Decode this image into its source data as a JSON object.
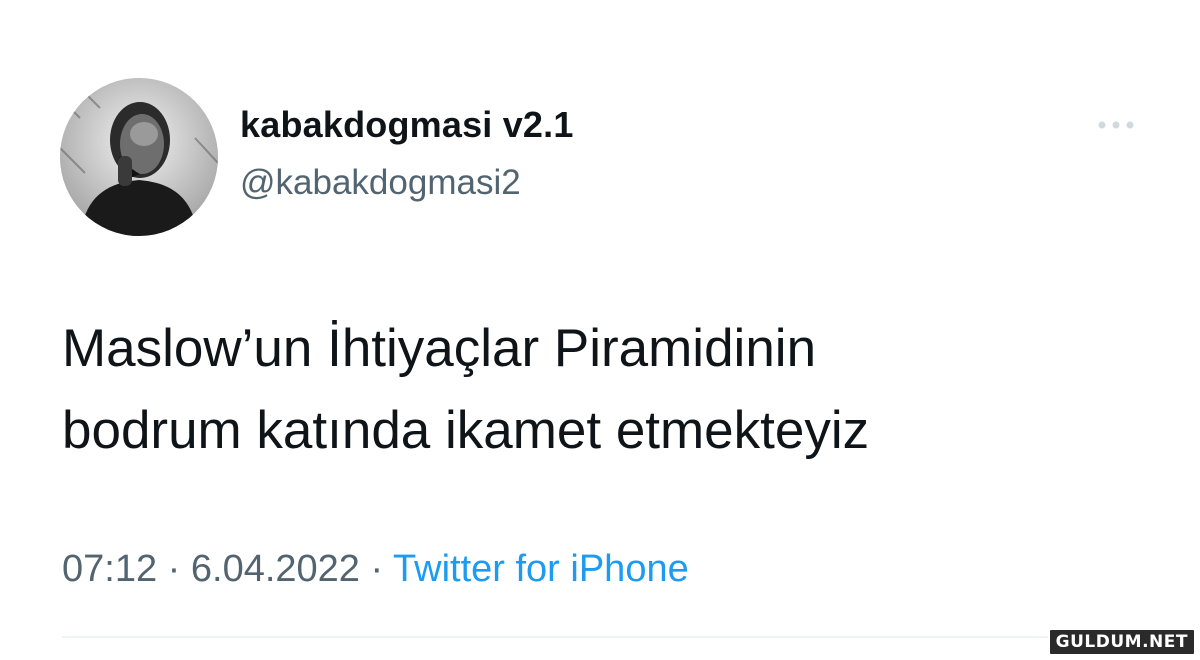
{
  "author": {
    "display_name": "kabakdogmasi v2.1",
    "handle": "@kabakdogmasi2",
    "avatar_icon": "profile-photo"
  },
  "menu": {
    "icon": "more-options-icon"
  },
  "tweet": {
    "lines": [
      "Maslow’un İhtiyaçlar Piramidinin",
      "bodrum katında ikamet etmekteyiz"
    ]
  },
  "meta": {
    "time": "07:12",
    "separator": "·",
    "date": "6.04.2022",
    "source": "Twitter for iPhone"
  },
  "watermark": "GULDUM.NET",
  "colors": {
    "text": "#0f1419",
    "secondary": "#536471",
    "link": "#1d9bf0",
    "divider": "#eff3f4"
  }
}
